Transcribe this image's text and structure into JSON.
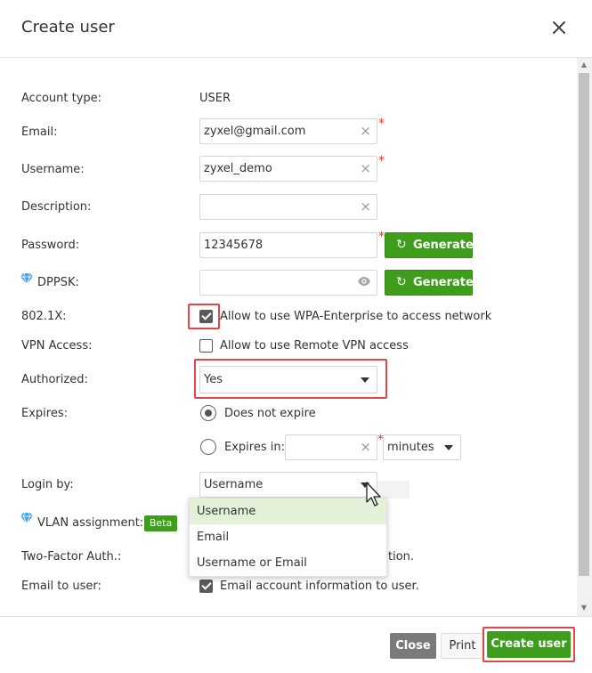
{
  "dialog": {
    "title": "Create user"
  },
  "labels": {
    "account_type": "Account type:",
    "email": "Email:",
    "username": "Username:",
    "description": "Description:",
    "password": "Password:",
    "dppsk": "DPPSK:",
    "dot1x": "802.1X:",
    "vpn_access": "VPN Access:",
    "authorized": "Authorized:",
    "expires": "Expires:",
    "login_by": "Login by:",
    "vlan_assignment": "VLAN assignment:",
    "two_factor": "Two-Factor Auth.:",
    "email_to_user": "Email to user:"
  },
  "values": {
    "account_type": "USER",
    "email": "zyxel@gmail.com",
    "username": "zyxel_demo",
    "description": "",
    "password": "12345678",
    "dppsk": "",
    "expires_in_value": ""
  },
  "buttons": {
    "generate_label": "Generate",
    "close_label": "Close",
    "print_label": "Print",
    "create_label": "Create user"
  },
  "checkboxes": {
    "dot1x": {
      "label": "Allow to use WPA-Enterprise to access network",
      "checked": true
    },
    "vpn": {
      "label": "Allow to use Remote VPN access",
      "checked": false
    },
    "email_user": {
      "label": "Email account information to user.",
      "checked": true
    }
  },
  "authorized": {
    "selected": "Yes"
  },
  "expires": {
    "option_never": "Does not expire",
    "option_in": "Expires in:",
    "selected": "never",
    "unit": "minutes"
  },
  "login_by": {
    "selected": "Username",
    "options": [
      "Username",
      "Email",
      "Username or Email"
    ]
  },
  "vlan": {
    "badge": "Beta"
  },
  "two_factor_partial": "tion.",
  "required_mark": "*",
  "icons": {
    "clear": "clear-x-icon",
    "eye": "eye-icon",
    "refresh": "refresh-icon",
    "gem": "diamond-icon",
    "close": "close-icon"
  },
  "colors": {
    "accent_green": "#3e9e1c",
    "highlight_red": "#e04848",
    "required_red": "#e53935",
    "selected_option_bg": "#e4f1d9",
    "gem_blue": "#4aa5e0"
  }
}
